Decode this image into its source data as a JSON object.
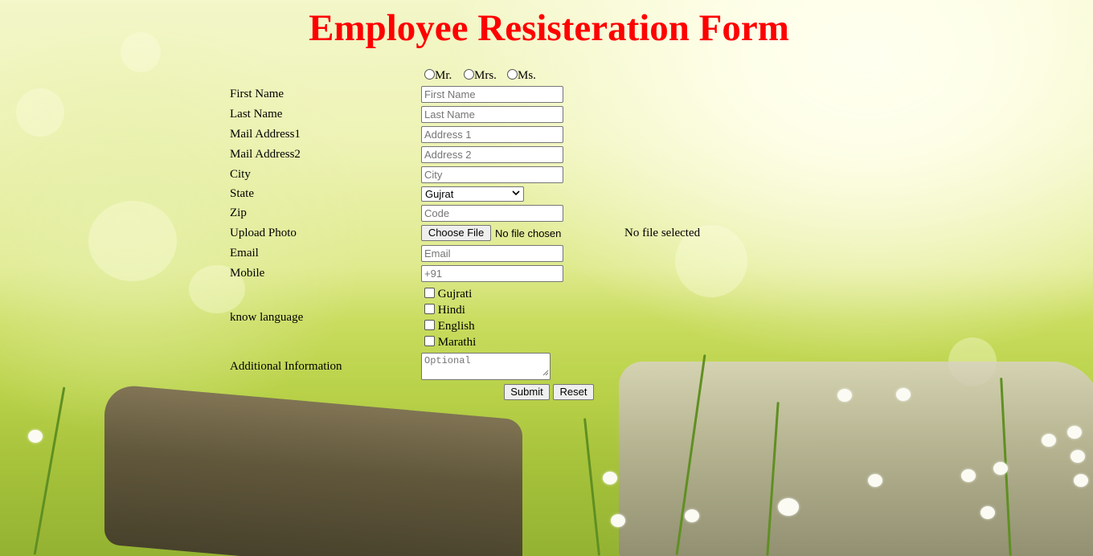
{
  "title": "Employee Resisteration Form",
  "salutation": {
    "options": [
      "Mr.",
      "Mrs.",
      "Ms."
    ]
  },
  "fields": {
    "first_name": {
      "label": "First Name",
      "placeholder": "First Name"
    },
    "last_name": {
      "label": "Last Name",
      "placeholder": "Last Name"
    },
    "address1": {
      "label": "Mail Address1",
      "placeholder": "Address 1"
    },
    "address2": {
      "label": "Mail Address2",
      "placeholder": "Address 2"
    },
    "city": {
      "label": "City",
      "placeholder": "City"
    },
    "state": {
      "label": "State",
      "selected": "Gujrat"
    },
    "zip": {
      "label": "Zip",
      "placeholder": "Code"
    },
    "photo": {
      "label": "Upload Photo",
      "button": "Choose File",
      "status": "No file chosen",
      "note": "No file selected"
    },
    "email": {
      "label": "Email",
      "placeholder": "Email"
    },
    "mobile": {
      "label": "Mobile",
      "placeholder": "+91"
    },
    "languages": {
      "label": "know language",
      "options": [
        "Gujrati",
        "Hindi",
        "English",
        "Marathi"
      ]
    },
    "additional": {
      "label": "Additional Information",
      "placeholder": "Optional"
    }
  },
  "buttons": {
    "submit": "Submit",
    "reset": "Reset"
  },
  "colors": {
    "title": "#ff0000",
    "background_top": "#f3f7c9",
    "background_bottom": "#94b232"
  },
  "icons": {
    "select_arrow": "chevron-down-icon",
    "resize": "resize-handle-icon"
  }
}
